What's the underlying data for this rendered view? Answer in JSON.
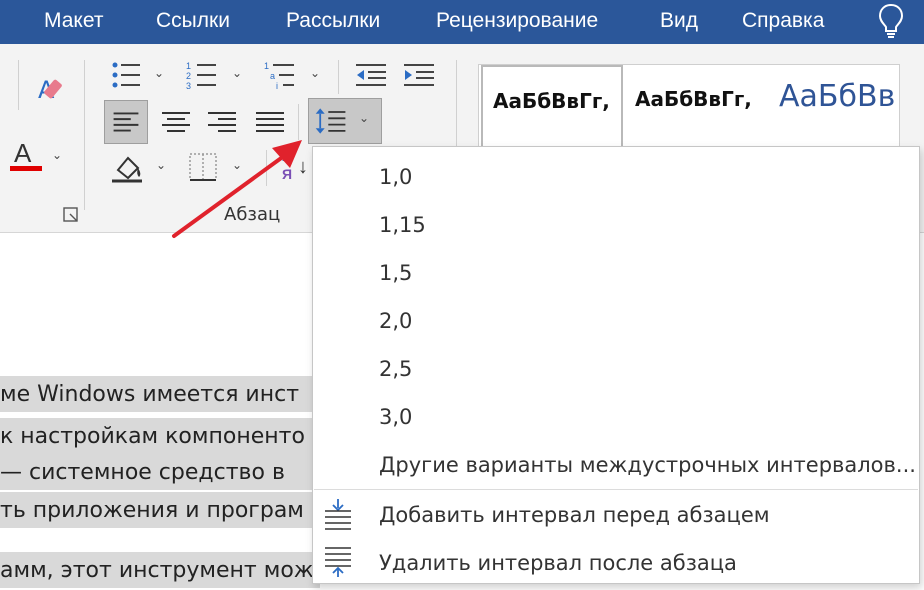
{
  "tabs": [
    {
      "label": "Макет"
    },
    {
      "label": "Ссылки"
    },
    {
      "label": "Рассылки"
    },
    {
      "label": "Рецензирование"
    },
    {
      "label": "Вид"
    },
    {
      "label": "Справка"
    }
  ],
  "ribbon": {
    "group_label": "Абзац",
    "sort_glyph_top": "А",
    "sort_glyph_bottom": "Я",
    "font_color_glyph": "A",
    "styles": [
      {
        "preview": "АаБбВвГг,"
      },
      {
        "preview": "АаБбВвГг,"
      },
      {
        "preview": "АаБбВв"
      }
    ]
  },
  "document": {
    "lines": [
      "ме Windows имеется инст",
      "к настройкам компоненто",
      "— системное средство в",
      "ть приложения и програм",
      "амм, этот инструмент мож"
    ]
  },
  "line_spacing_menu": {
    "options": [
      "1,0",
      "1,15",
      "1,5",
      "2,0",
      "2,5",
      "3,0"
    ],
    "more_options": "Другие варианты междустрочных интервалов...",
    "add_before": "Добавить интервал перед абзацем",
    "remove_after": "Удалить интервал после абзаца"
  },
  "colors": {
    "tabbar": "#2b579a",
    "font_color_underline": "#e00000",
    "annotation_arrow": "#e0222c",
    "style_blue": "#2f5496",
    "accent_icon": "#2b6cc4"
  },
  "icons": {
    "help": "lightbulb-icon",
    "line_spacing": "line-spacing-icon",
    "add_before": "add-space-before-icon",
    "remove_after": "remove-space-after-icon"
  }
}
